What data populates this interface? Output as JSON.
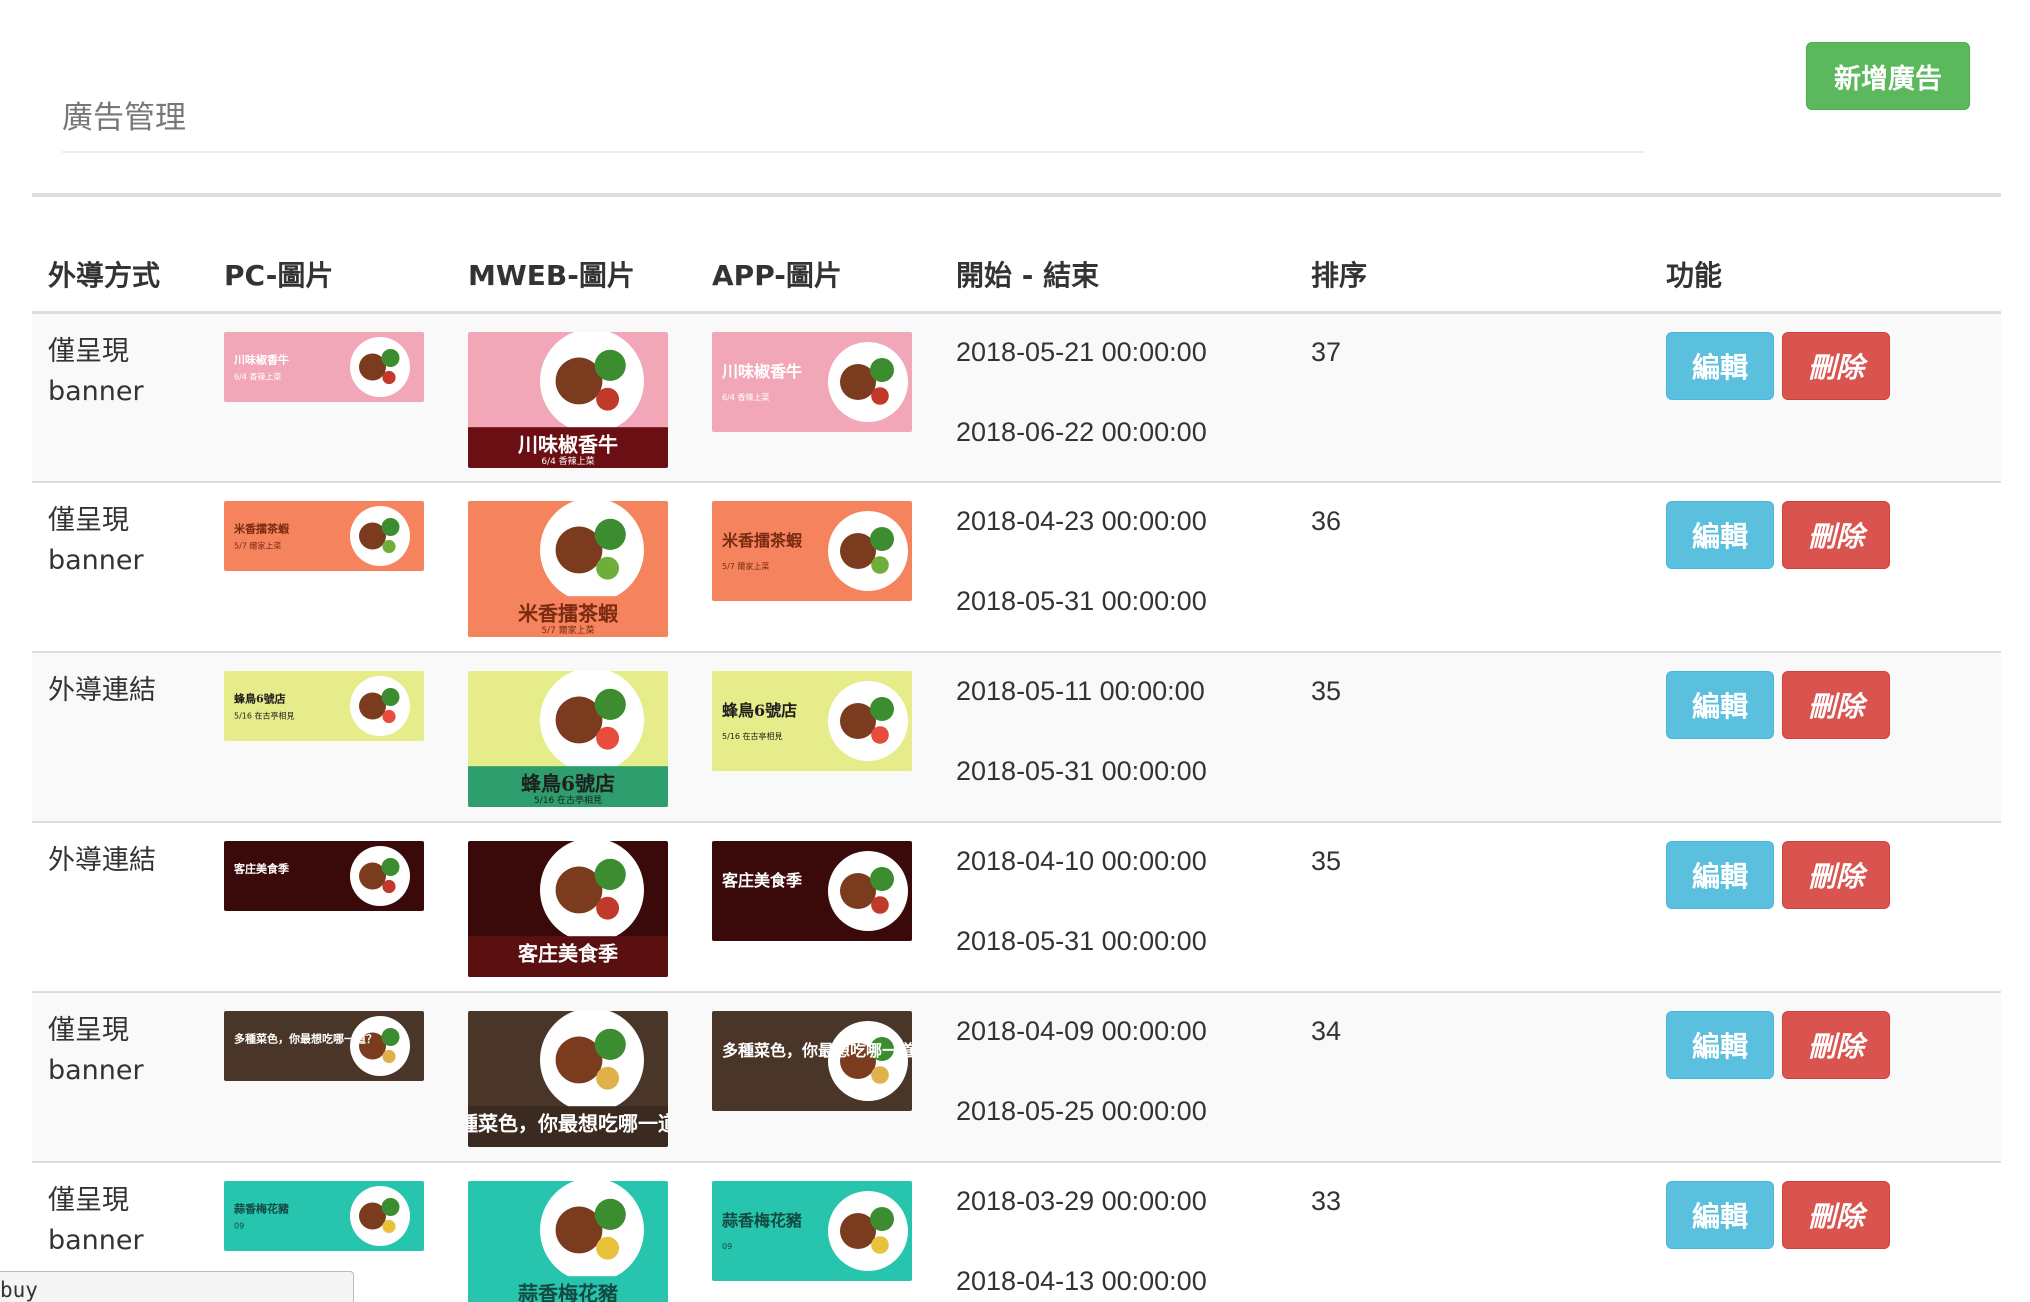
{
  "header": {
    "title": "廣告管理",
    "add_button_label": "新增廣告"
  },
  "table": {
    "columns": [
      "外導方式",
      "PC-圖片",
      "MWEB-圖片",
      "APP-圖片",
      "開始 - 結束",
      "排序",
      "功能"
    ],
    "edit_label": "編輯",
    "delete_label": "刪除",
    "rows": [
      {
        "method": "僅呈現 banner",
        "start": "2018-05-21 00:00:00",
        "end": "2018-06-22 00:00:00",
        "order": "37",
        "banner_text": "川味椒香牛",
        "banner_sub": "6/4 香辣上菜",
        "theme": "pink"
      },
      {
        "method": "僅呈現 banner",
        "start": "2018-04-23 00:00:00",
        "end": "2018-05-31 00:00:00",
        "order": "36",
        "banner_text": "米香擂茶蝦",
        "banner_sub": "5/7 爾家上菜",
        "theme": "orange"
      },
      {
        "method": "外導連結",
        "start": "2018-05-11 00:00:00",
        "end": "2018-05-31 00:00:00",
        "order": "35",
        "banner_text": "蜂鳥6號店",
        "banner_sub": "5/16 在古亭相見",
        "theme": "lime"
      },
      {
        "method": "外導連結",
        "start": "2018-04-10 00:00:00",
        "end": "2018-05-31 00:00:00",
        "order": "35",
        "banner_text": "客庄美食季",
        "banner_sub": "",
        "theme": "dark"
      },
      {
        "method": "僅呈現 banner",
        "start": "2018-04-09 00:00:00",
        "end": "2018-05-25 00:00:00",
        "order": "34",
        "banner_text": "多種菜色，你最想吃哪一道？",
        "banner_sub": "",
        "theme": "wood"
      },
      {
        "method": "僅呈現 banner",
        "start": "2018-03-29 00:00:00",
        "end": "2018-04-13 00:00:00",
        "order": "33",
        "banner_text": "蒜香梅花豬",
        "banner_sub": "09",
        "theme": "teal"
      }
    ]
  },
  "bottom_tab": {
    "text": "buy"
  },
  "colors": {
    "success": "#5cb85c",
    "info": "#5bc0de",
    "danger": "#d9534f"
  }
}
